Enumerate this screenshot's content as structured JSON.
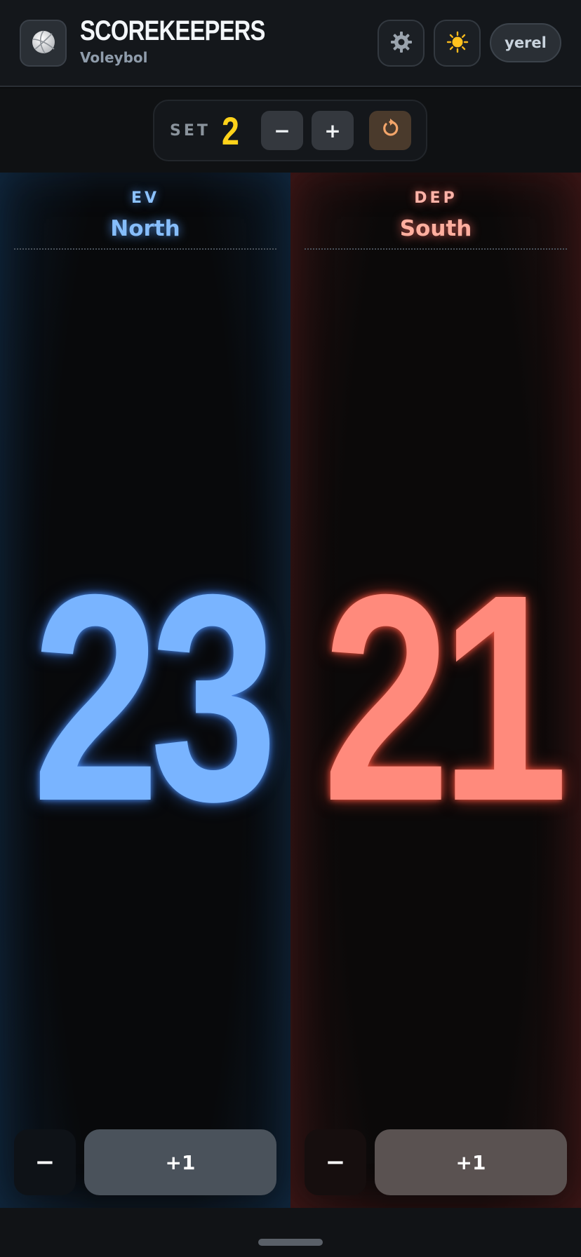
{
  "header": {
    "logo_icon": "volleyball-icon",
    "title": "SCOREKEEPERS",
    "subtitle": "Voleybol",
    "settings_icon": "gear-icon",
    "theme_icon": "sun-icon",
    "mode_label": "yerel"
  },
  "set_control": {
    "label": "SET",
    "value": "2",
    "decrement_label": "−",
    "increment_label": "+",
    "reset_icon": "reset-icon"
  },
  "teams": [
    {
      "tag": "EV",
      "name": "North",
      "score": "23",
      "minus_label": "−",
      "plus_label": "+1",
      "color": "#79b4ff"
    },
    {
      "tag": "DEP",
      "name": "South",
      "score": "21",
      "minus_label": "−",
      "plus_label": "+1",
      "color": "#ff8a7c"
    }
  ],
  "colors": {
    "accent_set": "#ffd21a",
    "home": "#79b4ff",
    "away": "#ff8a7c"
  }
}
